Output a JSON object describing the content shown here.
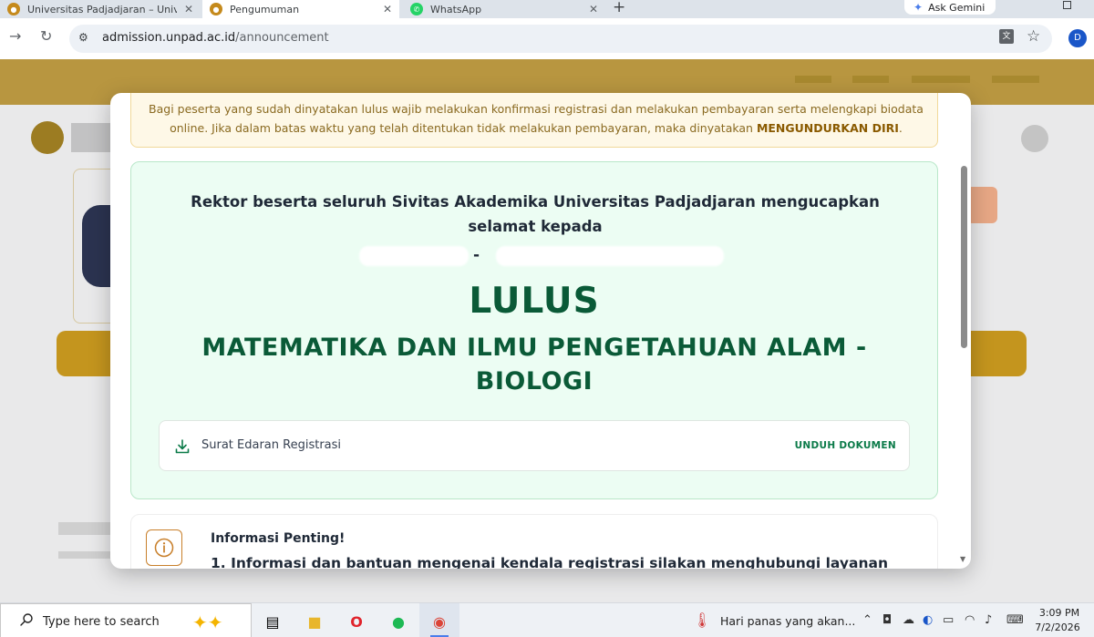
{
  "browser": {
    "tabs": [
      {
        "title": "Universitas Padjadjaran – Unive",
        "active": false
      },
      {
        "title": "Pengumuman",
        "active": true
      },
      {
        "title": "WhatsApp",
        "active": false
      }
    ],
    "new_tab_symbol": "+",
    "ask_gemini_label": "Ask Gemini",
    "url_host": "admission.unpad.ac.id",
    "url_path": "/announcement",
    "profile_initial": "D"
  },
  "modal": {
    "warning_text": "Bagi peserta yang sudah dinyatakan lulus wajib melakukan konfirmasi registrasi dan melakukan pembayaran serta melengkapi biodata online. Jika dalam batas waktu yang telah ditentukan tidak melakukan pembayaran, maka dinyatakan ",
    "warning_emphasis": "MENGUNDURKAN DIRI",
    "warning_end": ".",
    "congrats_text": "Rektor beserta seluruh Sivitas Akademika Universitas Padjadjaran mengucapkan selamat kepada",
    "name_separator": "-",
    "status": "LULUS",
    "program": "MATEMATIKA DAN ILMU PENGETAHUAN ALAM - BIOLOGI",
    "document": {
      "label": "Surat Edaran Registrasi",
      "action": "UNDUH DOKUMEN"
    },
    "info": {
      "title": "Informasi Penting!",
      "item_1": "1. Informasi dan bantuan mengenai kendala registrasi silakan menghubungi layanan"
    }
  },
  "taskbar": {
    "search_placeholder": "Type here to search",
    "weather_text": "Hari panas yang akan...",
    "time": "3:09 PM",
    "date": "7/2/2026"
  },
  "colors": {
    "status_green": "#0a5a37",
    "header_gold": "#b89640",
    "action_green": "#0a7a48"
  }
}
